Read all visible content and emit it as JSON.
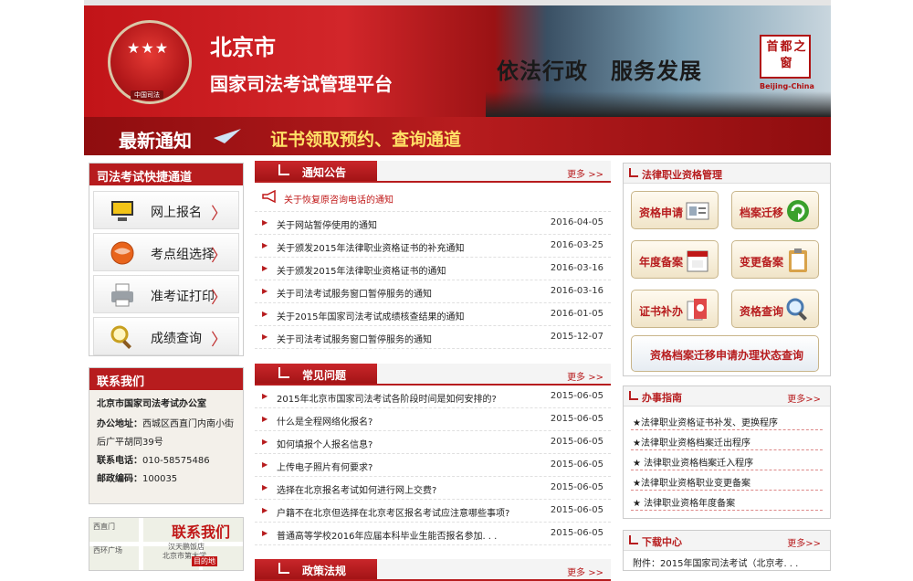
{
  "banner": {
    "city": "北京市",
    "platform": "国家司法考试管理平台",
    "slogan": "依法行政　服务发展",
    "seal_chars": "首都之窗",
    "seal_caption": "Beijing-China",
    "emblem_label": "中国司法",
    "emblem_stars": "★★★"
  },
  "notice_bar": {
    "title": "最新通知",
    "cert_link": "证书领取预约、查询通道"
  },
  "quick": {
    "title": "司法考试快捷通道",
    "items": [
      {
        "label": "网上报名",
        "icon": "computer-icon"
      },
      {
        "label": "考点组选择",
        "icon": "globe-icon"
      },
      {
        "label": "准考证打印",
        "icon": "printer-icon"
      },
      {
        "label": "成绩查询",
        "icon": "magnifier-icon"
      }
    ],
    "arrow": "〉"
  },
  "contact": {
    "title": "联系我们",
    "office": "北京市国家司法考试办公室",
    "address_label": "办公地址：",
    "address": "西城区西直门内南小街后广平胡同39号",
    "phone_label": "联系电话：",
    "phone": "010-58575486",
    "zip_label": "邮政编码：",
    "zip": "100035"
  },
  "map": {
    "title": "联系我们",
    "labels": [
      "西直门",
      "西环广场",
      "汉天鹏饭店",
      "北京市第大学",
      "目的地"
    ]
  },
  "notices": {
    "title": "通知公告",
    "more": "更多 >>",
    "highlight": "关于恢复原咨询电话的通知",
    "items": [
      {
        "title": "关于网站暂停使用的通知",
        "date": "2016-04-05"
      },
      {
        "title": "关于颁发2015年法律职业资格证书的补充通知",
        "date": "2016-03-25"
      },
      {
        "title": "关于颁发2015年法律职业资格证书的通知",
        "date": "2016-03-16"
      },
      {
        "title": "关于司法考试服务窗口暂停服务的通知",
        "date": "2016-03-16"
      },
      {
        "title": "关于2015年国家司法考试成绩核查结果的通知",
        "date": "2016-01-05"
      },
      {
        "title": "关于司法考试服务窗口暂停服务的通知",
        "date": "2015-12-07"
      }
    ]
  },
  "faq": {
    "title": "常见问题",
    "more": "更多 >>",
    "items": [
      {
        "title": "2015年北京市国家司法考试各阶段时间是如何安排的?",
        "date": "2015-06-05"
      },
      {
        "title": "什么是全程网络化报名?",
        "date": "2015-06-05"
      },
      {
        "title": "如何填报个人报名信息?",
        "date": "2015-06-05"
      },
      {
        "title": "上传电子照片有何要求?",
        "date": "2015-06-05"
      },
      {
        "title": "选择在北京报名考试如何进行网上交费?",
        "date": "2015-06-05"
      },
      {
        "title": "户籍不在北京但选择在北京考区报名考试应注意哪些事项?",
        "date": "2015-06-05"
      },
      {
        "title": "普通高等学校2016年应届本科毕业生能否报名参加. . .",
        "date": "2015-06-05"
      }
    ]
  },
  "policy": {
    "title": "政策法规",
    "more": "更多 >>"
  },
  "qualification": {
    "title": "法律职业资格管理",
    "buttons": [
      {
        "label": "资格申请",
        "icon": "id-card-icon"
      },
      {
        "label": "档案迁移",
        "icon": "refresh-icon"
      },
      {
        "label": "年度备案",
        "icon": "calendar-icon"
      },
      {
        "label": "变更备案",
        "icon": "clipboard-icon"
      },
      {
        "label": "证书补办",
        "icon": "certificate-icon"
      },
      {
        "label": "资格查询",
        "icon": "magnifier-icon"
      }
    ],
    "wide": "资格档案迁移申请办理状态查询"
  },
  "guide": {
    "title": "办事指南",
    "more": "更多>>",
    "items": [
      "★法律职业资格证书补发、更换程序",
      "★法律职业资格档案迁出程序",
      "★ 法律职业资格档案迁入程序",
      "★法律职业资格职业变更备案",
      "★ 法律职业资格年度备案"
    ]
  },
  "download": {
    "title": "下载中心",
    "more": "更多>>",
    "items": [
      "附件：2015年国家司法考试（北京考. . ."
    ]
  },
  "colors": {
    "brand": "#b71c1e",
    "dark": "#8f0d0f",
    "seal": "#b01010"
  }
}
